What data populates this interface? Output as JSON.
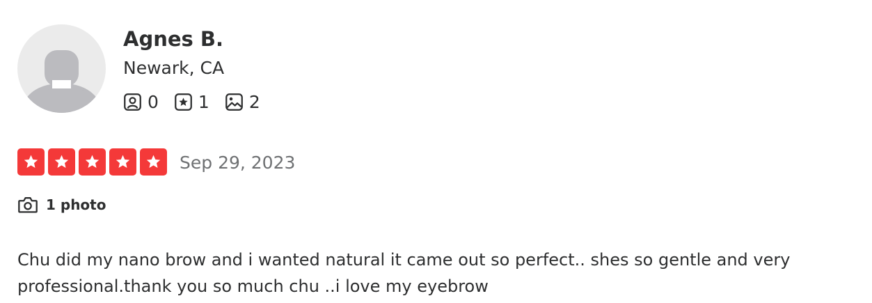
{
  "reviewer": {
    "name": "Agnes B.",
    "location": "Newark, CA",
    "stats": {
      "friends": "0",
      "reviews": "1",
      "photos": "2"
    }
  },
  "review": {
    "rating": 5,
    "rating_max": 5,
    "date": "Sep 29, 2023",
    "photo_count_label": "1 photo",
    "text": "Chu did my nano brow and i wanted natural it came out so perfect.. shes so gentle and very professional.thank you so much chu ..i love my eyebrow"
  },
  "colors": {
    "star_red": "#f43939",
    "text_dark": "#2d2e2f",
    "text_muted": "#6e7072",
    "avatar_bg": "#ebebeb",
    "avatar_figure": "#bbbbbf"
  },
  "icons": {
    "friends": "friends-icon",
    "reviews": "review-star-icon",
    "photos": "photos-icon",
    "camera": "camera-icon",
    "star": "star-icon"
  }
}
